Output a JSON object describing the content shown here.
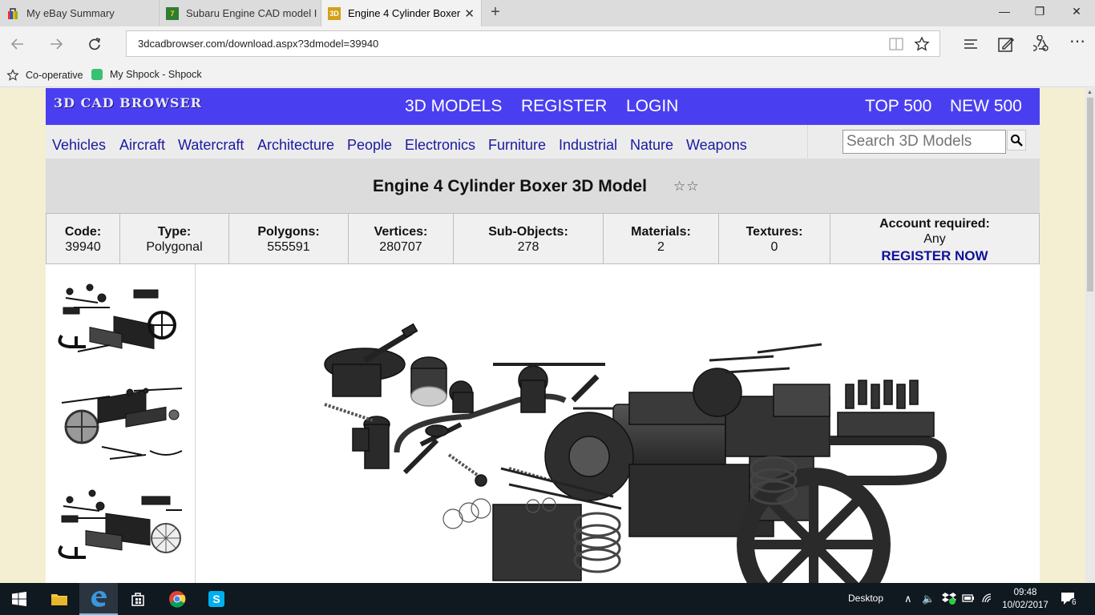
{
  "browser": {
    "tabs": [
      {
        "title": "My eBay Summary",
        "icon": "ebay-bag-icon"
      },
      {
        "title": "Subaru Engine CAD model I",
        "icon": "site-7-icon"
      },
      {
        "title": "Engine 4 Cylinder Boxer",
        "icon": "3d-icon",
        "active": true
      }
    ],
    "url": "3dcadbrowser.com/download.aspx?3dmodel=39940",
    "favorites": [
      {
        "label": "Co-operative",
        "icon": "star-outline-icon"
      },
      {
        "label": "My Shpock - Shpock",
        "icon": "shpock-icon"
      }
    ]
  },
  "site": {
    "logo": "3D CAD BROWSER",
    "main_nav": [
      "3D MODELS",
      "REGISTER",
      "LOGIN"
    ],
    "right_nav": [
      "TOP 500",
      "NEW 500"
    ],
    "categories": [
      "Vehicles",
      "Aircraft",
      "Watercraft",
      "Architecture",
      "People",
      "Electronics",
      "Furniture",
      "Industrial",
      "Nature",
      "Weapons"
    ],
    "search_placeholder": "Search 3D Models",
    "model_title": "Engine 4 Cylinder Boxer 3D Model",
    "rating": "☆☆",
    "specs": [
      {
        "label": "Code:",
        "value": "39940"
      },
      {
        "label": "Type:",
        "value": "Polygonal"
      },
      {
        "label": "Polygons:",
        "value": "555591"
      },
      {
        "label": "Vertices:",
        "value": "280707"
      },
      {
        "label": "Sub-Objects:",
        "value": "278"
      },
      {
        "label": "Materials:",
        "value": "2"
      },
      {
        "label": "Textures:",
        "value": "0"
      }
    ],
    "account": {
      "label": "Account required:",
      "value": "Any",
      "cta": "REGISTER NOW"
    }
  },
  "taskbar": {
    "desktop_label": "Desktop",
    "time": "09:48",
    "date": "10/02/2017",
    "notifications": "6"
  }
}
